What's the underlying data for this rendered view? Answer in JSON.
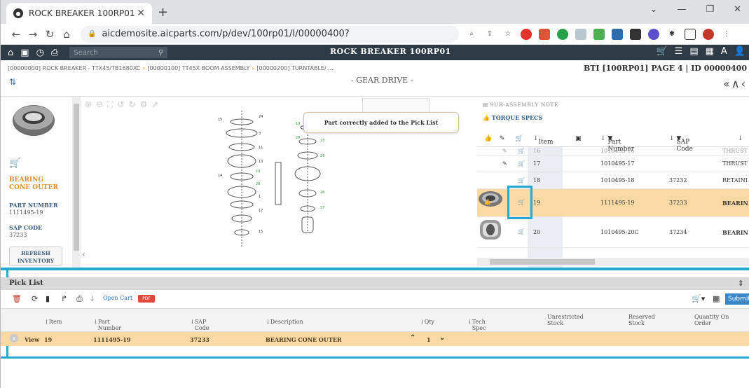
{
  "browser": {
    "tab_title": "ROCK BREAKER 100RP01",
    "url": "aicdemosite.aicparts.com/p/dev/100rp01/I/00000400?"
  },
  "app": {
    "search_placeholder": "Search",
    "title": "ROCK BREAKER 100RP01",
    "breadcrumb": [
      "[00000000] ROCK BREAKER - TTX45/TB1680XC",
      "[00000100] TT45X BOOM ASSEMBLY",
      "[00000200] TURNTABLE/ ..."
    ],
    "bti": "BTI [100RP01]   PAGE 4 | ID 00000400",
    "page_title": "- GEAR DRIVE -"
  },
  "left_panel": {
    "part_name": "BEARING CONE OUTER",
    "part_number_label": "PART NUMBER",
    "part_number": "1111495-19",
    "sap_code_label": "SAP CODE",
    "sap_code": "37233",
    "refresh_label": "REFRESH INVENTORY"
  },
  "toast": "Part correctly added to the Pick List",
  "parts_table": {
    "sub_assembly_note": "SUB-ASSEMBLY NOTE",
    "torque_specs": "TORQUE SPECS",
    "headers": {
      "item": "Item",
      "part_number": "Part Number",
      "sap_code": "SAP Code"
    },
    "rows": [
      {
        "item": "16",
        "part_number": "1010495-16",
        "sap_code": "",
        "desc": "THRUST"
      },
      {
        "item": "17",
        "part_number": "1010495-17",
        "sap_code": "",
        "desc": "THRUST"
      },
      {
        "item": "18",
        "part_number": "1010495-18",
        "sap_code": "37232",
        "desc": "RETAINI"
      },
      {
        "item": "19",
        "part_number": "1111495-19",
        "sap_code": "37233",
        "desc": "BEARIN"
      },
      {
        "item": "20",
        "part_number": "1010495-20C",
        "sap_code": "37234",
        "desc": "BEARIN"
      }
    ]
  },
  "pick_list": {
    "title": "Pick List",
    "open_cart": "Open Cart",
    "pdf": "PDF",
    "submit": "Submit",
    "headers": {
      "item": "Item",
      "part_number": "Part Number",
      "sap_code": "SAP Code",
      "description": "Description",
      "qty": "Qty",
      "tech_spec": "Tech Spec",
      "unrestricted": "Unrestricted Stock",
      "reserved": "Reserved Stock",
      "on_order": "Quantity On Order"
    },
    "row": {
      "view": "View",
      "item": "19",
      "part_number": "1111495-19",
      "sap_code": "37233",
      "description": "BEARING CONE OUTER",
      "qty": "1"
    }
  },
  "colors": {
    "accent": "#26a9d1",
    "cart": "#f2a33a",
    "selected_row": "#fbd9a5",
    "header": "#2e3a45"
  }
}
